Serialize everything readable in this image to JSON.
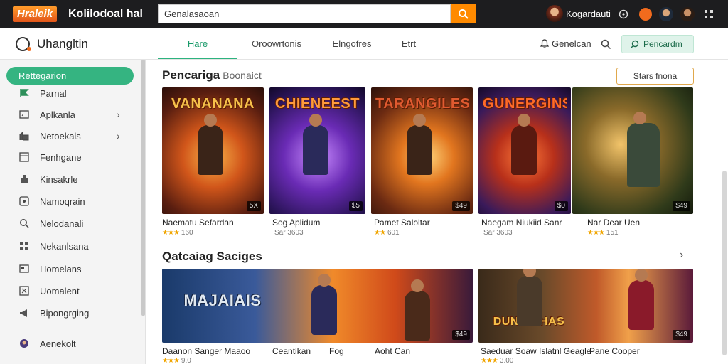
{
  "topbar": {
    "logo_text": "Hraleik",
    "brand_text": "Kolilodoal hal",
    "search_value": "Genalasaoan",
    "user_name": "Kogardauti"
  },
  "navbar": {
    "app_name": "Uhangltin",
    "tabs": [
      {
        "label": "Hare",
        "active": true
      },
      {
        "label": "Oroowrtonis",
        "active": false
      },
      {
        "label": "Elngofres",
        "active": false
      },
      {
        "label": "Etrt",
        "active": false
      }
    ],
    "notify_label": "Genelcan",
    "cta_label": "Pencardm"
  },
  "sidebar": {
    "active_label": "Rettegarion",
    "items": [
      {
        "label": "Parnal",
        "icon": "pennant-icon",
        "has_arrow": false
      },
      {
        "label": "Aplkanla",
        "icon": "monitor-icon",
        "has_arrow": true
      },
      {
        "label": "Netoekals",
        "icon": "building-icon",
        "has_arrow": true
      },
      {
        "label": "Fenhgane",
        "icon": "window-icon",
        "has_arrow": false
      },
      {
        "label": "Kinsakrle",
        "icon": "store-icon",
        "has_arrow": false
      },
      {
        "label": "Namoqrain",
        "icon": "chat-icon",
        "has_arrow": false
      },
      {
        "label": "Nelodanali",
        "icon": "search-icon",
        "has_arrow": false
      },
      {
        "label": "Nekanlsana",
        "icon": "grid-icon",
        "has_arrow": false
      },
      {
        "label": "Homelans",
        "icon": "card-icon",
        "has_arrow": false
      },
      {
        "label": "Uomalent",
        "icon": "puzzle-icon",
        "has_arrow": false
      },
      {
        "label": "Bipongrging",
        "icon": "megaphone-icon",
        "has_arrow": false
      },
      {
        "label": "Aenekolt",
        "icon": "avatar-icon",
        "has_arrow": false
      }
    ]
  },
  "section1": {
    "title": "Pencariga",
    "subtitle": "Boonaict",
    "see_more": "Stars fnona",
    "cards": [
      {
        "banner": "VANANANA",
        "tag": "5X",
        "title": "Naematu Sefardan",
        "meta": "160",
        "stars": "★★★"
      },
      {
        "banner": "CHIENEEST",
        "tag": "$5",
        "title": "Sog Aplidum",
        "meta": "Sar 3603",
        "stars": ""
      },
      {
        "banner": "TARANGILES",
        "tag": "$49",
        "title": "Pamet Saloltar",
        "meta": "601",
        "stars": "★★"
      },
      {
        "banner": "GUNERGINS",
        "tag": "$0",
        "title": "Naegam Niukiid Sanr",
        "meta": "Sar 3603",
        "stars": ""
      },
      {
        "banner": "",
        "tag": "$49",
        "title": "Nar Dear Uen",
        "meta": "151",
        "stars": "★★★"
      }
    ]
  },
  "section2": {
    "title": "Qatcaiag Saciges",
    "cards": [
      {
        "banner": "MAJAIAIS",
        "tag": "$49",
        "title": "Daanon Sanger Maaoo",
        "title2": "Ceantikan",
        "title3": "Fog",
        "title4": "Aoht Can",
        "meta": "9.0",
        "stars": "★★★"
      },
      {
        "banner": "DUNDRIHAS",
        "tag": "$49",
        "title": "Saeduar Soaw Islatnl Geagle",
        "title2": "Pane Cooper",
        "meta": "3.00",
        "stars": "★★★"
      }
    ]
  },
  "colors": {
    "accent": "#35b481",
    "topbar": "#1d1d1f",
    "search_button": "#ff8a00"
  }
}
